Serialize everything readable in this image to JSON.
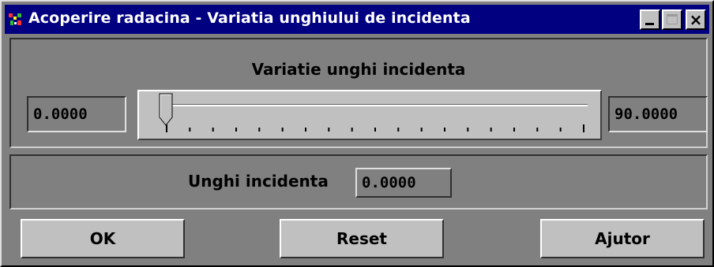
{
  "window": {
    "title": "Acoperire radacina - Variatia unghiului de incidenta",
    "controls": {
      "minimize_icon": "minimize-icon",
      "maximize_icon": "maximize-icon",
      "close_icon": "close-icon",
      "close_glyph": "×"
    },
    "colors": {
      "titlebar": "#000080",
      "face": "#808080",
      "button_face": "#c0c0c0"
    }
  },
  "slider_group": {
    "title": "Variatie unghi incidenta",
    "min_value": "0.0000",
    "max_value": "90.0000",
    "slider": {
      "position_fraction": 0.0,
      "tick_count": 19
    }
  },
  "incidence_group": {
    "label": "Unghi incidenta",
    "value": "0.0000"
  },
  "buttons": {
    "ok": "OK",
    "reset": "Reset",
    "help": "Ajutor"
  }
}
